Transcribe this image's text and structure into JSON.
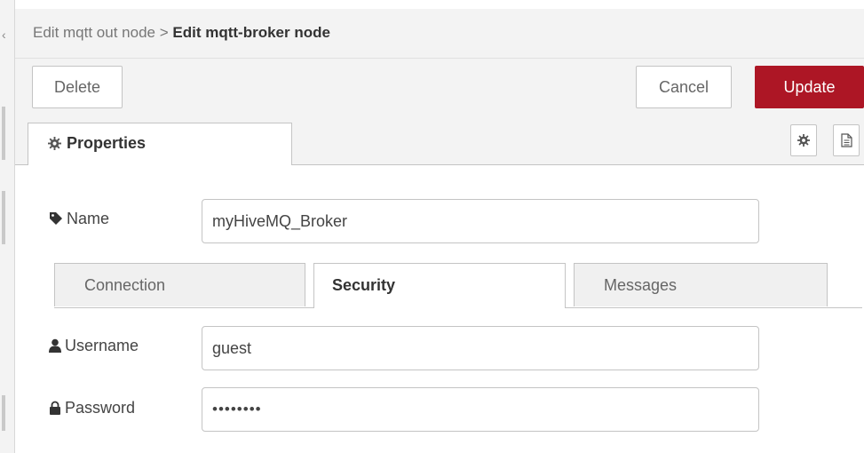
{
  "header": {
    "breadcrumb_parent": "Edit mqtt out node >",
    "breadcrumb_current": "Edit mqtt-broker node"
  },
  "toolbar": {
    "delete_label": "Delete",
    "cancel_label": "Cancel",
    "update_label": "Update"
  },
  "tabs": {
    "properties_label": "Properties",
    "settings_icon": "gear-icon",
    "description_icon": "document-icon"
  },
  "form": {
    "name_label": "Name",
    "name_value": "myHiveMQ_Broker",
    "username_label": "Username",
    "username_value": "guest",
    "password_label": "Password",
    "password_value": "••••••••"
  },
  "subtabs": [
    {
      "label": "Connection",
      "active": false
    },
    {
      "label": "Security",
      "active": true
    },
    {
      "label": "Messages",
      "active": false
    }
  ],
  "colors": {
    "update_button": "#ad1625",
    "panel_background": "#f3f3f3"
  }
}
